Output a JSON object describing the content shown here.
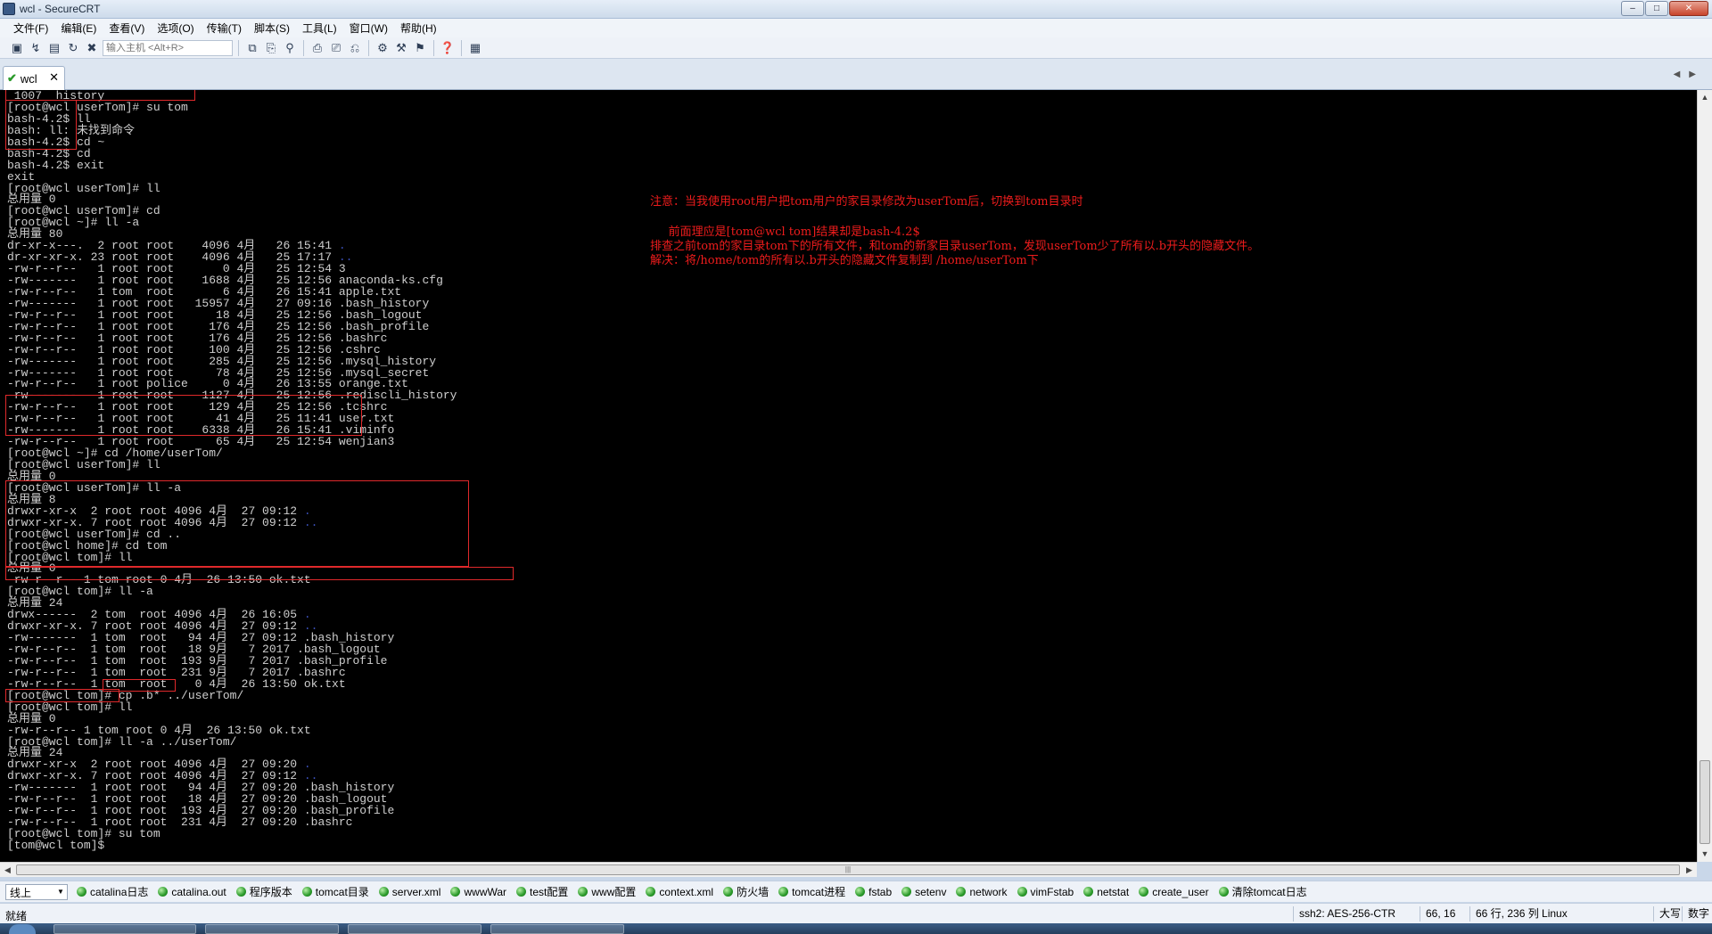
{
  "window": {
    "title": "wcl - SecureCRT",
    "controls": [
      "minimize",
      "maximize",
      "close"
    ]
  },
  "menu": [
    "文件(F)",
    "编辑(E)",
    "查看(V)",
    "选项(O)",
    "传输(T)",
    "脚本(S)",
    "工具(L)",
    "窗口(W)",
    "帮助(H)"
  ],
  "toolbar": {
    "host_placeholder": "输入主机 <Alt+R>",
    "icons": [
      "connect-icon",
      "quick-connect-icon",
      "connect-tab-icon",
      "reconnect-icon",
      "disconnect-icon",
      "copy-icon",
      "paste-icon",
      "find-icon",
      "print-icon",
      "print-selection-icon",
      "printer-icon",
      "session-options-icon",
      "global-options-icon",
      "keymap-icon",
      "help-icon",
      "sftp-icon"
    ]
  },
  "tabs": [
    {
      "label": "wcl",
      "active": true,
      "connected": true
    }
  ],
  "terminal": {
    "lines": [
      " 1007  history",
      "[root@wcl userTom]# su tom",
      "bash-4.2$ ll",
      "bash: ll: 未找到命令",
      "bash-4.2$ cd ~",
      "bash-4.2$ cd",
      "bash-4.2$ exit",
      "exit",
      "[root@wcl userTom]# ll",
      "总用量 0",
      "[root@wcl userTom]# cd",
      "[root@wcl ~]# ll -a",
      "总用量 80",
      "dr-xr-x---.  2 root root    4096 4月   26 15:41 .",
      "dr-xr-xr-x. 23 root root    4096 4月   25 17:17 ..",
      "-rw-r--r--   1 root root       0 4月   25 12:54 3",
      "-rw-------   1 root root    1688 4月   25 12:56 anaconda-ks.cfg",
      "-rw-r--r--   1 tom  root       6 4月   26 15:41 apple.txt",
      "-rw-------   1 root root   15957 4月   27 09:16 .bash_history",
      "-rw-r--r--   1 root root      18 4月   25 12:56 .bash_logout",
      "-rw-r--r--   1 root root     176 4月   25 12:56 .bash_profile",
      "-rw-r--r--   1 root root     176 4月   25 12:56 .bashrc",
      "-rw-r--r--   1 root root     100 4月   25 12:56 .cshrc",
      "-rw-------   1 root root     285 4月   25 12:56 .mysql_history",
      "-rw-------   1 root root      78 4月   25 12:56 .mysql_secret",
      "-rw-r--r--   1 root police     0 4月   26 13:55 orange.txt",
      "-rw-------   1 root root    1127 4月   25 12:56 .rediscli_history",
      "-rw-r--r--   1 root root     129 4月   25 12:56 .tcshrc",
      "-rw-r--r--   1 root root      41 4月   25 11:41 user.txt",
      "-rw-------   1 root root    6338 4月   26 15:41 .viminfo",
      "-rw-r--r--   1 root root      65 4月   25 12:54 wenjian3",
      "[root@wcl ~]# cd /home/userTom/",
      "[root@wcl userTom]# ll",
      "总用量 0",
      "[root@wcl userTom]# ll -a",
      "总用量 8",
      "drwxr-xr-x  2 root root 4096 4月  27 09:12 .",
      "drwxr-xr-x. 7 root root 4096 4月  27 09:12 ..",
      "[root@wcl userTom]# cd ..",
      "[root@wcl home]# cd tom",
      "[root@wcl tom]# ll",
      "总用量 0",
      "-rw-r--r-- 1 tom root 0 4月  26 13:50 ok.txt",
      "[root@wcl tom]# ll -a",
      "总用量 24",
      "drwx------  2 tom  root 4096 4月  26 16:05 .",
      "drwxr-xr-x. 7 root root 4096 4月  27 09:12 ..",
      "-rw-------  1 tom  root   94 4月  27 09:12 .bash_history",
      "-rw-r--r--  1 tom  root   18 9月   7 2017 .bash_logout",
      "-rw-r--r--  1 tom  root  193 9月   7 2017 .bash_profile",
      "-rw-r--r--  1 tom  root  231 9月   7 2017 .bashrc",
      "-rw-r--r--  1 tom  root    0 4月  26 13:50 ok.txt",
      "[root@wcl tom]# cp .b* ../userTom/",
      "[root@wcl tom]# ll",
      "总用量 0",
      "-rw-r--r-- 1 tom root 0 4月  26 13:50 ok.txt",
      "[root@wcl tom]# ll -a ../userTom/",
      "总用量 24",
      "drwxr-xr-x  2 root root 4096 4月  27 09:20 .",
      "drwxr-xr-x. 7 root root 4096 4月  27 09:12 ..",
      "-rw-------  1 root root   94 4月  27 09:20 .bash_history",
      "-rw-r--r--  1 root root   18 4月  27 09:20 .bash_logout",
      "-rw-r--r--  1 root root  193 4月  27 09:20 .bash_profile",
      "-rw-r--r--  1 root root  231 4月  27 09:20 .bashrc",
      "[root@wcl tom]# su tom",
      "[tom@wcl tom]$ "
    ],
    "annotation": [
      "注意：当我使用root用户把tom用户的家目录修改为userTom后，切换到tom目录时",
      "",
      "     前面理应是[tom@wcl tom]结果却是bash-4.2$",
      "排查之前tom的家目录tom下的所有文件，和tom的新家目录userTom，发现userTom少了所有以.b开头的隐藏文件。",
      "解决：将/home/tom的所有以.b开头的隐藏文件复制到 /home/userTom下"
    ]
  },
  "button_bar": {
    "session_select": "线上",
    "buttons": [
      "catalina日志",
      "catalina.out",
      "程序版本",
      "tomcat目录",
      "server.xml",
      "wwwWar",
      "test配置",
      "www配置",
      "context.xml",
      "防火墙",
      "tomcat进程",
      "fstab",
      "setenv",
      "network",
      "vimFstab",
      "netstat",
      "create_user",
      "清除tomcat日志"
    ]
  },
  "status": {
    "ready": "就绪",
    "encryption": "ssh2: AES-256-CTR",
    "position": "66,  16",
    "size": "66 行, 236 列 Linux",
    "capslock": "大写",
    "numlock": "数字"
  }
}
